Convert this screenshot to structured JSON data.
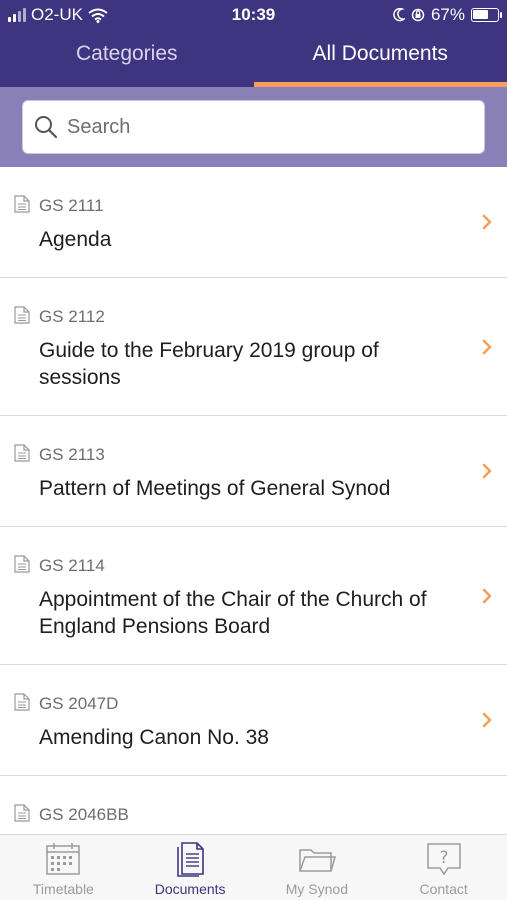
{
  "status_bar": {
    "carrier": "O2-UK",
    "time": "10:39",
    "battery": "67%",
    "battery_level": 0.67
  },
  "tabs": [
    {
      "label": "Categories",
      "active": false
    },
    {
      "label": "All Documents",
      "active": true
    }
  ],
  "search": {
    "placeholder": "Search",
    "value": ""
  },
  "documents": [
    {
      "code": "GS 2111",
      "title": "Agenda"
    },
    {
      "code": "GS 2112",
      "title": "Guide to the February 2019 group of sessions"
    },
    {
      "code": "GS 2113",
      "title": "Pattern of Meetings of General Synod"
    },
    {
      "code": "GS 2114",
      "title": "Appointment of the Chair of the Church of England Pensions Board"
    },
    {
      "code": "GS 2047D",
      "title": "Amending Canon No. 38"
    },
    {
      "code": "GS 2046BB",
      "title": ""
    }
  ],
  "bottom_nav": [
    {
      "label": "Timetable",
      "icon": "calendar-icon",
      "active": false
    },
    {
      "label": "Documents",
      "icon": "documents-icon",
      "active": true
    },
    {
      "label": "My Synod",
      "icon": "folder-icon",
      "active": false
    },
    {
      "label": "Contact",
      "icon": "help-bubble-icon",
      "active": false
    }
  ],
  "colors": {
    "header": "#3f3480",
    "tab_indicator": "#f4a05a",
    "chevron": "#f4a05a",
    "search_band": "#8a80b8",
    "nav_active": "#3f3480",
    "nav_inactive": "#9b9b9b"
  }
}
